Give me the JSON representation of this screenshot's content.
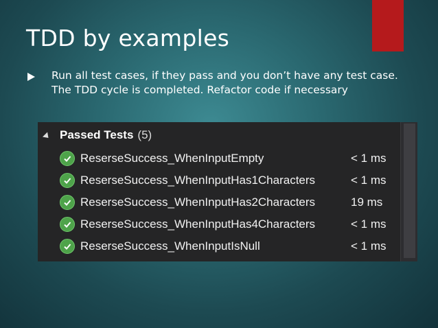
{
  "slide": {
    "title": "TDD by examples",
    "bullet": "Run all test cases, if they pass and you don’t have any test case. The TDD cycle is completed. Refactor code if necessary",
    "accent_color": "#b51a1c"
  },
  "test_explorer": {
    "group_label": "Passed Tests",
    "group_count": "(5)",
    "status_color": "#4ea34a",
    "tests": [
      {
        "name": "ReserseSuccess_WhenInputEmpty",
        "duration": "< 1 ms"
      },
      {
        "name": "ReserseSuccess_WhenInputHas1Characters",
        "duration": "< 1 ms"
      },
      {
        "name": "ReserseSuccess_WhenInputHas2Characters",
        "duration": "19 ms"
      },
      {
        "name": "ReserseSuccess_WhenInputHas4Characters",
        "duration": "< 1 ms"
      },
      {
        "name": "ReserseSuccess_WhenInputIsNull",
        "duration": "< 1 ms"
      }
    ]
  }
}
